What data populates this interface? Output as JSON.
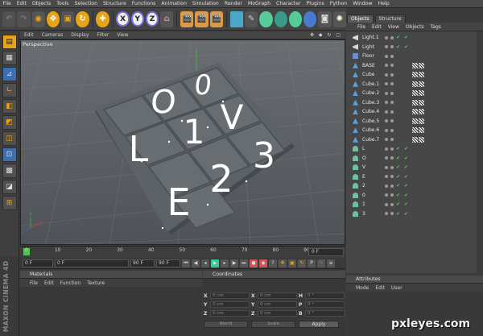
{
  "menubar": [
    "File",
    "Edit",
    "Objects",
    "Tools",
    "Selection",
    "Structure",
    "Functions",
    "Animation",
    "Simulation",
    "Render",
    "MoGraph",
    "Character",
    "Plugins",
    "Python",
    "Window",
    "Help"
  ],
  "toolbar": {
    "axis_x": "X",
    "axis_y": "Y",
    "axis_z": "Z"
  },
  "viewport": {
    "menu": [
      "Edit",
      "Cameras",
      "Display",
      "Filter",
      "View"
    ],
    "icons": "✥ ◆ ↻ ▢",
    "label": "Perspective",
    "tiles": [
      "O",
      "0",
      "L",
      "1",
      "V",
      "E",
      "2",
      "3"
    ],
    "axis_x": "X",
    "axis_y": "Y",
    "axis_z": "Z"
  },
  "timeline": {
    "ticks": [
      "0",
      "10",
      "20",
      "30",
      "40",
      "50",
      "60",
      "70",
      "80",
      "90"
    ],
    "end": "0 F"
  },
  "transport": {
    "current": "0 F",
    "start": "0 F",
    "end_a": "90 F",
    "end_b": "90 F"
  },
  "materials": {
    "title": "Materials",
    "menu": [
      "File",
      "Edit",
      "Function",
      "Texture"
    ]
  },
  "coordinates": {
    "title": "Coordinates",
    "rows": [
      {
        "a": "X",
        "av": "0 cm",
        "b": "X",
        "bv": "0 cm",
        "c": "H",
        "cv": "0 °"
      },
      {
        "a": "Y",
        "av": "0 cm",
        "b": "Y",
        "bv": "0 cm",
        "c": "P",
        "cv": "0 °"
      },
      {
        "a": "Z",
        "av": "0 cm",
        "b": "Z",
        "bv": "0 cm",
        "c": "B",
        "cv": "0 °"
      }
    ],
    "mode_a": "World",
    "mode_b": "Scale",
    "apply": "Apply"
  },
  "object_manager": {
    "tabs": [
      "Objects",
      "Structure"
    ],
    "menu": [
      "File",
      "Edit",
      "View",
      "Objects",
      "Tags"
    ],
    "objects": [
      {
        "name": "Light.1",
        "type": "light",
        "tags": false
      },
      {
        "name": "Light",
        "type": "light",
        "tags": false
      },
      {
        "name": "Floor",
        "type": "floor",
        "tags": false
      },
      {
        "name": "BASE",
        "type": "cube",
        "tags": true
      },
      {
        "name": "Cube",
        "type": "cube",
        "tags": true
      },
      {
        "name": "Cube.1",
        "type": "cube",
        "tags": true
      },
      {
        "name": "Cube.2",
        "type": "cube",
        "tags": true
      },
      {
        "name": "Cube.3",
        "type": "cube",
        "tags": true
      },
      {
        "name": "Cube.4",
        "type": "cube",
        "tags": true
      },
      {
        "name": "Cube.5",
        "type": "cube",
        "tags": true
      },
      {
        "name": "Cube.6",
        "type": "cube",
        "tags": true
      },
      {
        "name": "Cube.7",
        "type": "cube",
        "tags": true
      },
      {
        "name": "L",
        "type": "text",
        "tags": false
      },
      {
        "name": "O",
        "type": "text",
        "tags": false
      },
      {
        "name": "V",
        "type": "text",
        "tags": false
      },
      {
        "name": "E",
        "type": "text",
        "tags": false
      },
      {
        "name": "2",
        "type": "text",
        "tags": false
      },
      {
        "name": "0",
        "type": "text",
        "tags": false
      },
      {
        "name": "1",
        "type": "text",
        "tags": false
      },
      {
        "name": "3",
        "type": "text",
        "tags": false
      }
    ]
  },
  "attributes": {
    "title": "Attributes",
    "menu": [
      "Mode",
      "Edit",
      "User"
    ]
  },
  "branding": {
    "maxon": "MAXON CINEMA 4D",
    "watermark": "pxleyes.com"
  }
}
